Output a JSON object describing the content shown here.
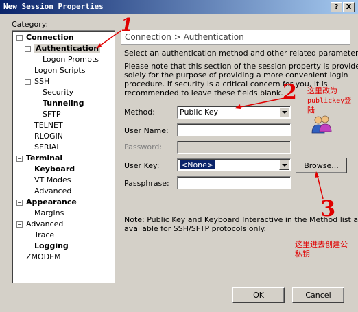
{
  "window": {
    "title": "New Session Properties",
    "help_label": "?",
    "close_label": "X"
  },
  "category_label": "Category:",
  "tree": [
    {
      "label": "Connection",
      "bold": true,
      "expander": "−"
    },
    {
      "label": "Authentication",
      "bold": true,
      "expander": "−",
      "selected": true
    },
    {
      "label": "Logon Prompts",
      "bold": false
    },
    {
      "label": "Logon Scripts",
      "bold": false
    },
    {
      "label": "SSH",
      "bold": false,
      "expander": "−"
    },
    {
      "label": "Security",
      "bold": false
    },
    {
      "label": "Tunneling",
      "bold": true
    },
    {
      "label": "SFTP",
      "bold": false
    },
    {
      "label": "TELNET",
      "bold": false
    },
    {
      "label": "RLOGIN",
      "bold": false
    },
    {
      "label": "SERIAL",
      "bold": false
    },
    {
      "label": "Terminal",
      "bold": true,
      "expander": "−"
    },
    {
      "label": "Keyboard",
      "bold": true
    },
    {
      "label": "VT Modes",
      "bold": false
    },
    {
      "label": "Advanced",
      "bold": false
    },
    {
      "label": "Appearance",
      "bold": true,
      "expander": "−"
    },
    {
      "label": "Margins",
      "bold": false
    },
    {
      "label": "Advanced",
      "bold": false,
      "expander": "−"
    },
    {
      "label": "Trace",
      "bold": false
    },
    {
      "label": "Logging",
      "bold": true
    },
    {
      "label": "ZMODEM",
      "bold": false
    }
  ],
  "panel": {
    "breadcrumb": "Connection > Authentication",
    "intro": "Select an authentication method and other related parameters.",
    "note_lines": [
      "Please note that this section of the session property is provided",
      "solely for the purpose of providing a more convenient login",
      "procedure. If security is a critical concern for you, it is",
      "recommended to leave these fields blank."
    ],
    "method_label": "Method:",
    "method_value": "Public Key",
    "username_label": "User Name:",
    "username_value": "",
    "password_label": "Password:",
    "userkey_label": "User Key:",
    "userkey_value": "<None>",
    "browse_label": "Browse...",
    "passphrase_label": "Passphrase:",
    "passphrase_value": "",
    "footnote_lines": [
      "Note: Public Key and Keyboard Interactive in the Method list are",
      "available for SSH/SFTP protocols only."
    ]
  },
  "buttons": {
    "ok": "OK",
    "cancel": "Cancel"
  },
  "annotations": {
    "num1": "1",
    "num2": "2",
    "num3": "3",
    "note2_line1": "这里改为",
    "note2_line2": "publickey登",
    "note2_line3": "陆",
    "note3_line1": "这里进去创建公",
    "note3_line2": "私钥"
  },
  "colors": {
    "accent": "#0a246a",
    "annotation": "#e00000",
    "selection": "#0a246a"
  }
}
